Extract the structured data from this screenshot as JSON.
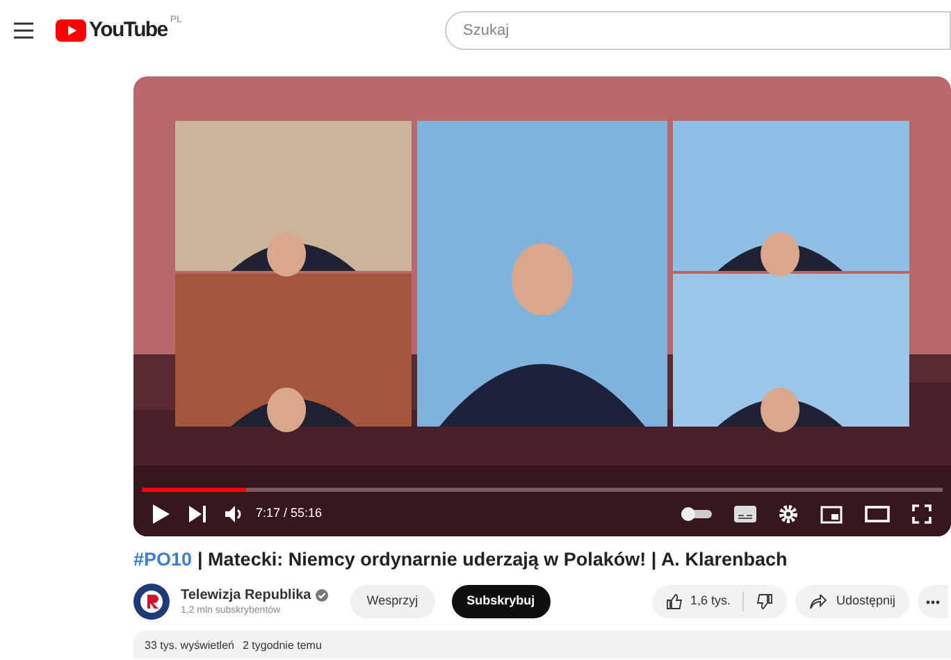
{
  "header": {
    "logo_text": "YouTube",
    "region": "PL",
    "search": {
      "placeholder": "Szukaj"
    }
  },
  "player": {
    "progress": {
      "level": 0.13
    },
    "time": "7:17 / 55:16"
  },
  "video": {
    "hashtag": "#PO10",
    "title": "| Matecki: Niemcy ordynarnie uderzają w Polaków! | A. Klarenbach"
  },
  "channel": {
    "name": "Telewizja Republika",
    "verified": true,
    "subscribers": "1,2 mln subskrybentów"
  },
  "actions": {
    "support": "Wesprzyj",
    "subscribe": "Subskrybuj",
    "likes": "1,6 tys.",
    "share": "Udostępnij"
  },
  "description": {
    "views": "33 tys. wyświetleń",
    "date": "2 tygodnie temu"
  }
}
